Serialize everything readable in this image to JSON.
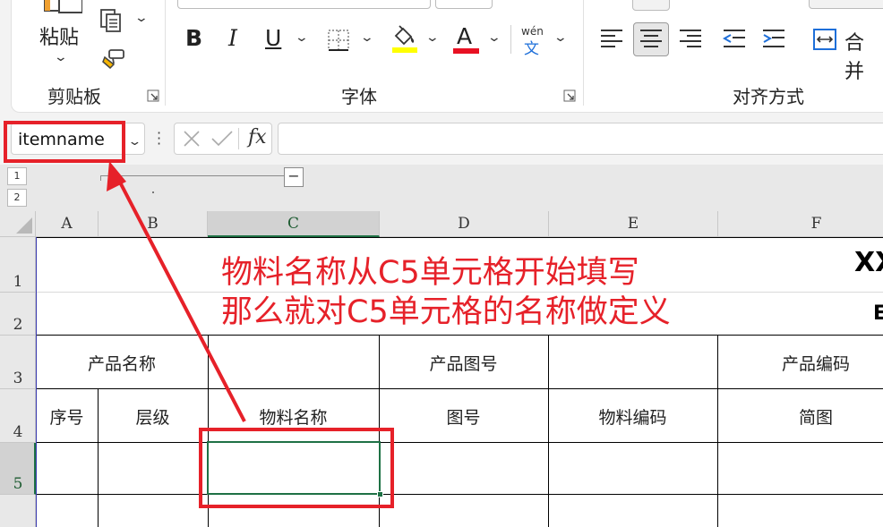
{
  "ribbon": {
    "clipboard": {
      "paste_label": "粘贴",
      "group_label": "剪贴板"
    },
    "font": {
      "bold_label": "B",
      "italic_label": "I",
      "underline_label": "U",
      "font_color_label": "A",
      "phonetic_top": "wén",
      "phonetic_bottom": "文",
      "group_label": "字体",
      "fill_color": "#ffff00",
      "font_color": "#e81123"
    },
    "alignment": {
      "merge_label": "合并",
      "group_label": "对齐方式"
    }
  },
  "formula_bar": {
    "name_box_value": "itemname",
    "fx_label": "fx",
    "formula_value": ""
  },
  "outline": {
    "level_buttons": [
      "1",
      "2"
    ],
    "collapse_label": "−"
  },
  "columns": [
    "A",
    "B",
    "C",
    "D",
    "E",
    "F"
  ],
  "rows": [
    "1",
    "2",
    "3",
    "4",
    "5"
  ],
  "sheet": {
    "title_fragment": "XX",
    "subtitle_fragment": "E",
    "row3": {
      "product_name": "产品名称",
      "product_drawing_no": "产品图号",
      "product_code": "产品编码"
    },
    "row4": {
      "seq": "序号",
      "level": "层级",
      "material_name": "物料名称",
      "drawing_no": "图号",
      "material_code": "物料编码",
      "sketch": "简图"
    }
  },
  "annotation": {
    "line1": "物料名称从C5单元格开始填写",
    "line2": "那么就对C5单元格的名称做定义",
    "color": "#e62129"
  }
}
